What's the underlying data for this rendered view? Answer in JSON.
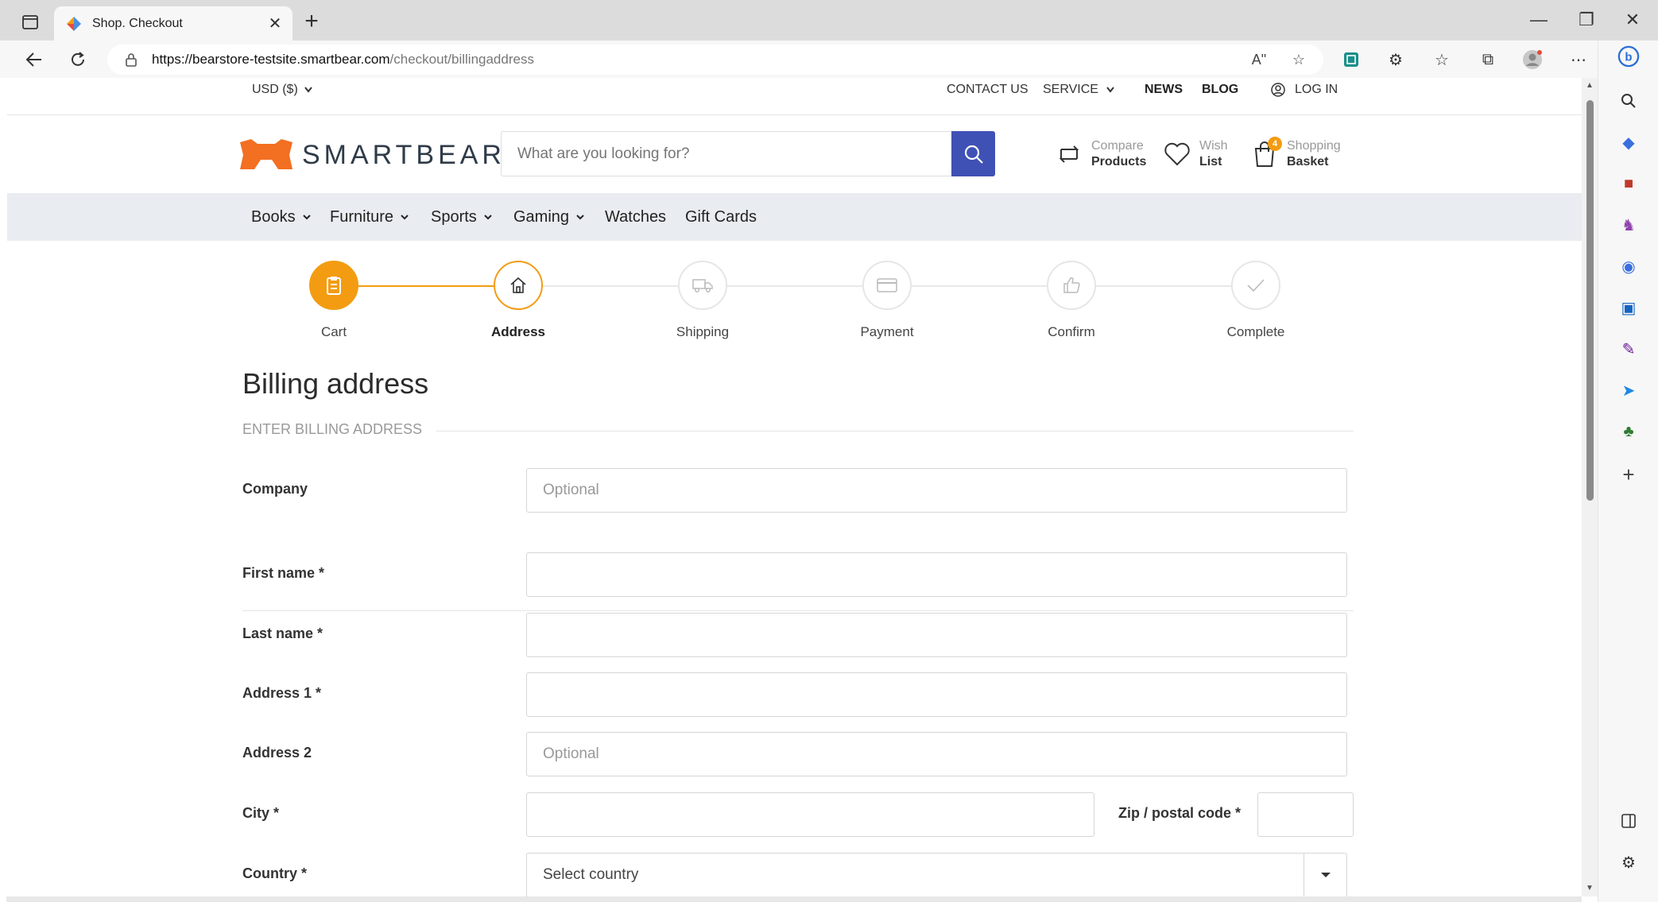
{
  "browser": {
    "tab_title": "Shop. Checkout",
    "tab_close": "✕",
    "new_tab": "+",
    "url_host": "https://bearstore-testsite.smartbear.com",
    "url_path": "/checkout/billingaddress",
    "win_minimize": "—",
    "win_restore": "❐",
    "win_close": "✕",
    "read_aloud": "Aʺ"
  },
  "topbar": {
    "currency": "USD  ($)",
    "contact": "CONTACT US",
    "service": "SERVICE",
    "news": "NEWS",
    "blog": "BLOG",
    "login": "LOG IN"
  },
  "header": {
    "logo_text": "SMARTBEAR",
    "search_placeholder": "What are you looking for?",
    "compare_l1": "Compare",
    "compare_l2": "Products",
    "wish_l1": "Wish",
    "wish_l2": "List",
    "basket_l1": "Shopping",
    "basket_l2": "Basket",
    "basket_count": "4",
    "brand_color": "#f39c12",
    "search_button_color": "#3f51b5"
  },
  "menu": {
    "items": [
      {
        "label": "Books"
      },
      {
        "label": "Furniture"
      },
      {
        "label": "Sports"
      },
      {
        "label": "Gaming"
      },
      {
        "label": "Watches"
      },
      {
        "label": "Gift Cards"
      }
    ]
  },
  "steps": [
    {
      "label": "Cart",
      "icon": "clipboard-icon",
      "state": "done"
    },
    {
      "label": "Address",
      "icon": "home-icon",
      "state": "active"
    },
    {
      "label": "Shipping",
      "icon": "truck-icon",
      "state": "pending"
    },
    {
      "label": "Payment",
      "icon": "credit-card-icon",
      "state": "pending"
    },
    {
      "label": "Confirm",
      "icon": "thumbs-up-icon",
      "state": "pending"
    },
    {
      "label": "Complete",
      "icon": "check-icon",
      "state": "pending"
    }
  ],
  "form": {
    "title": "Billing address",
    "section": "ENTER BILLING ADDRESS",
    "company_label": "Company",
    "company_placeholder": "Optional",
    "first_name_label": "First name *",
    "last_name_label": "Last name *",
    "address1_label": "Address 1 *",
    "address2_label": "Address 2",
    "address2_placeholder": "Optional",
    "city_label": "City *",
    "zip_label": "Zip / postal code *",
    "country_label": "Country *",
    "country_value": "Select country"
  }
}
